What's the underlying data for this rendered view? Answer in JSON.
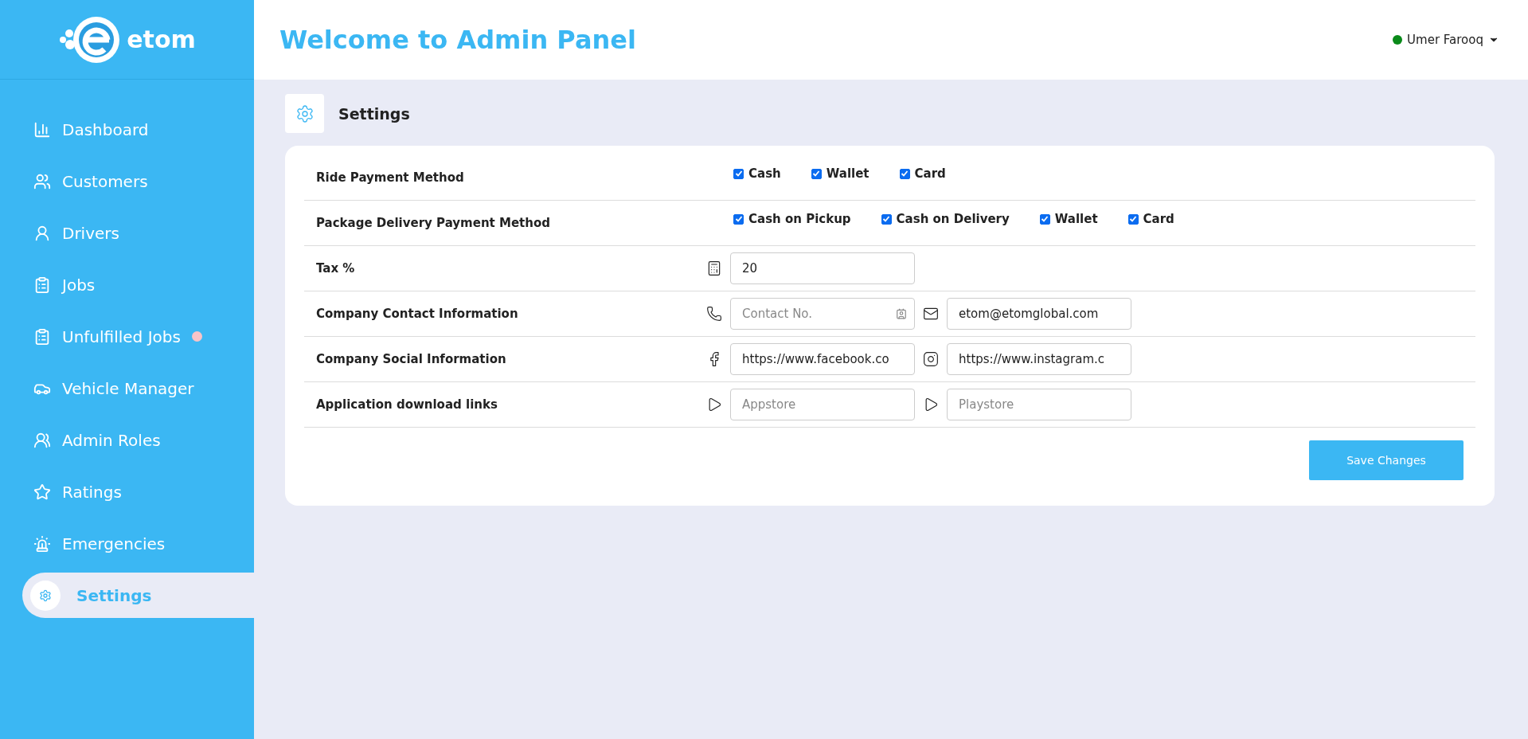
{
  "logo": {
    "text": "etom"
  },
  "sidebar": {
    "items": [
      {
        "label": "Dashboard",
        "selected": false,
        "alert": false
      },
      {
        "label": "Customers",
        "selected": false,
        "alert": false
      },
      {
        "label": "Drivers",
        "selected": false,
        "alert": false
      },
      {
        "label": "Jobs",
        "selected": false,
        "alert": false
      },
      {
        "label": "Unfulfilled Jobs",
        "selected": false,
        "alert": true
      },
      {
        "label": "Vehicle Manager",
        "selected": false,
        "alert": false
      },
      {
        "label": "Admin Roles",
        "selected": false,
        "alert": false
      },
      {
        "label": "Ratings",
        "selected": false,
        "alert": false
      },
      {
        "label": "Emergencies",
        "selected": false,
        "alert": false
      },
      {
        "label": "Settings",
        "selected": true,
        "alert": false
      }
    ]
  },
  "header": {
    "title": "Welcome to Admin Panel",
    "user": {
      "name": "Umer Farooq",
      "online": true
    }
  },
  "page": {
    "title": "Settings"
  },
  "settings": {
    "rows": [
      {
        "label": "Ride Payment Method",
        "kind": "checkboxes",
        "options": [
          {
            "label": "Cash",
            "checked": true
          },
          {
            "label": "Wallet",
            "checked": true
          },
          {
            "label": "Card",
            "checked": true
          }
        ]
      },
      {
        "label": "Package Delivery Payment Method",
        "kind": "checkboxes",
        "options": [
          {
            "label": "Cash on Pickup",
            "checked": true
          },
          {
            "label": "Cash on Delivery",
            "checked": true
          },
          {
            "label": "Wallet",
            "checked": true
          },
          {
            "label": "Card",
            "checked": true
          }
        ]
      },
      {
        "label": "Tax %",
        "kind": "fields",
        "fields": [
          {
            "value": "20"
          }
        ]
      },
      {
        "label": "Company Contact Information",
        "kind": "fields",
        "fields": [
          {
            "placeholder": "Contact No."
          },
          {
            "value": "etom@etomglobal.com"
          }
        ]
      },
      {
        "label": "Company Social Information",
        "kind": "fields",
        "fields": [
          {
            "value": "https://www.facebook.co"
          },
          {
            "value": "https://www.instagram.c"
          }
        ]
      },
      {
        "label": "Application download links",
        "kind": "fields",
        "fields": [
          {
            "placeholder": "Appstore"
          },
          {
            "placeholder": "Playstore"
          }
        ]
      }
    ]
  },
  "save_button": "Save Changes"
}
